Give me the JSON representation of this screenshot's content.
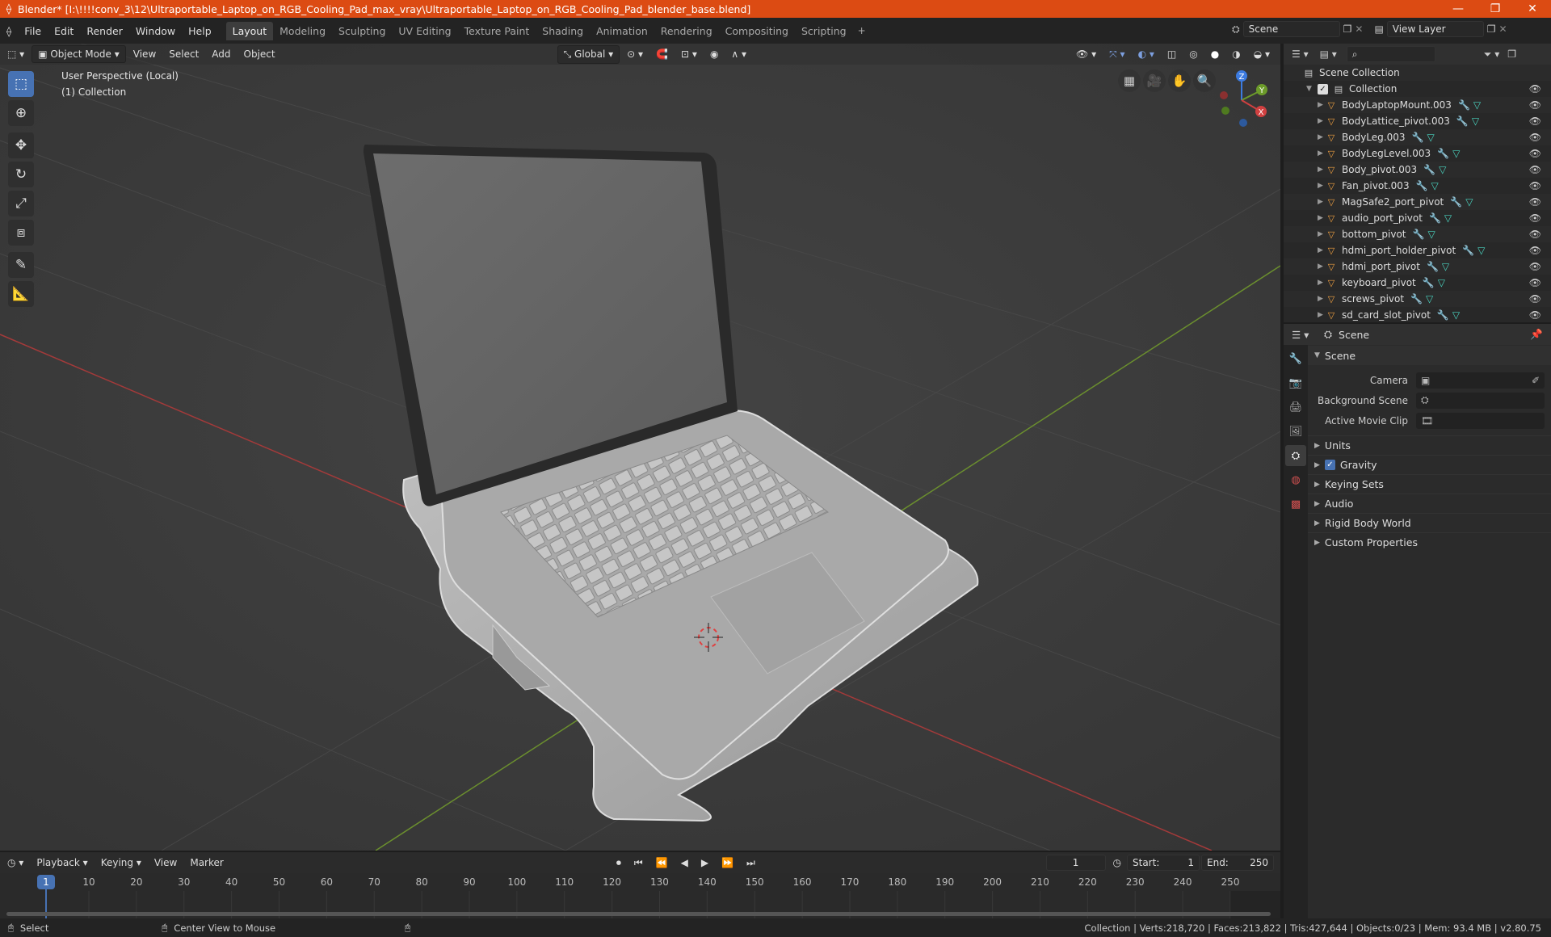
{
  "window": {
    "title": "Blender* [I:\\!!!!conv_3\\12\\Ultraportable_Laptop_on_RGB_Cooling_Pad_max_vray\\Ultraportable_Laptop_on_RGB_Cooling_Pad_blender_base.blend]",
    "minimize": "—",
    "maximize": "❐",
    "close": "✕"
  },
  "menu": [
    "File",
    "Edit",
    "Render",
    "Window",
    "Help"
  ],
  "workspaces": [
    "Layout",
    "Modeling",
    "Sculpting",
    "UV Editing",
    "Texture Paint",
    "Shading",
    "Animation",
    "Rendering",
    "Compositing",
    "Scripting"
  ],
  "workspace_add": "+",
  "scene": {
    "name": "Scene",
    "view_layer": "View Layer"
  },
  "viewport": {
    "mode": "Object Mode",
    "menus": [
      "View",
      "Select",
      "Add",
      "Object"
    ],
    "orientation": "Global",
    "info_line1": "User Perspective (Local)",
    "info_line2": "(1) Collection",
    "gizmo_axes": {
      "x": "X",
      "y": "Y",
      "z": "Z"
    }
  },
  "outliner": {
    "root": "Scene Collection",
    "collection": "Collection",
    "items": [
      "BodyLaptopMount.003",
      "BodyLattice_pivot.003",
      "BodyLeg.003",
      "BodyLegLevel.003",
      "Body_pivot.003",
      "Fan_pivot.003",
      "MagSafe2_port_pivot",
      "audio_port_pivot",
      "bottom_pivot",
      "hdmi_port_holder_pivot",
      "hdmi_port_pivot",
      "keyboard_pivot",
      "screws_pivot",
      "sd_card_slot_pivot"
    ]
  },
  "properties": {
    "header": "Scene",
    "panel": "Scene",
    "fields": [
      {
        "label": "Camera"
      },
      {
        "label": "Background Scene"
      },
      {
        "label": "Active Movie Clip"
      }
    ],
    "sections": [
      "Units",
      "Gravity",
      "Keying Sets",
      "Audio",
      "Rigid Body World",
      "Custom Properties"
    ],
    "gravity_checked": true
  },
  "timeline": {
    "menus": [
      "Playback",
      "Keying",
      "View",
      "Marker"
    ],
    "current_frame": "1",
    "start_label": "Start:",
    "start": "1",
    "end_label": "End:",
    "end": "250",
    "ticks": [
      "1",
      "10",
      "20",
      "30",
      "40",
      "50",
      "60",
      "70",
      "80",
      "90",
      "100",
      "110",
      "120",
      "130",
      "140",
      "150",
      "160",
      "170",
      "180",
      "190",
      "200",
      "210",
      "220",
      "230",
      "240",
      "250"
    ]
  },
  "status": {
    "left": "Select",
    "middle": "Center View to Mouse",
    "right": "Collection | Verts:218,720 | Faces:213,822 | Tris:427,644 | Objects:0/23 | Mem: 93.4 MB | v2.80.75"
  },
  "colors": {
    "accent": "#4772b3",
    "title_bar": "#dc4b13",
    "viewport_bg": "#3d3d3d",
    "axis_x": "#c23a3a",
    "axis_y": "#6b9a2a"
  }
}
